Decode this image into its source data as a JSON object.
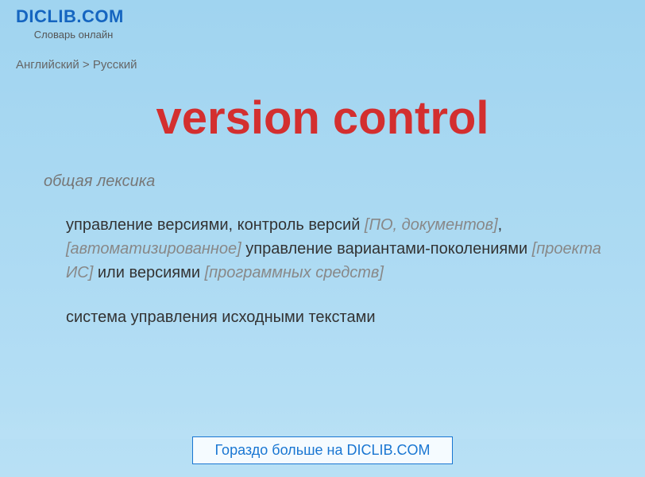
{
  "header": {
    "site_title": "DICLIB.COM",
    "site_subtitle": "Словарь онлайн"
  },
  "breadcrumb": {
    "from": "Английский",
    "separator": " > ",
    "to": "Русский"
  },
  "main": {
    "title": "version control",
    "category": "общая лексика",
    "definition1": {
      "t1": "управление версиями, контроль версий ",
      "q1": "[ПО, документов]",
      "c1": ", ",
      "q2": "[автоматизированное]",
      "t2": " управление вариантами-поколениями ",
      "q3": "[проекта ИС]",
      "t3": " или версиями ",
      "q4": "[программных средств]"
    },
    "definition2": "система управления исходными текстами"
  },
  "footer": {
    "link_text": "Гораздо больше на DICLIB.COM"
  }
}
